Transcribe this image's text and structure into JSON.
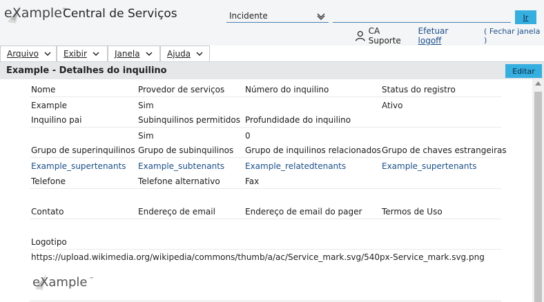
{
  "header": {
    "logo_text": "eXample",
    "logo_tm": "™",
    "app_title": "Central de Serviços",
    "search_type": "Incidente",
    "search_value": "",
    "go_label": "Ir",
    "user_name": "CA Suporte",
    "logoff_prefix": "Efetuar ",
    "logoff_underlined": "logoff",
    "close_window": "( Fechar janela )"
  },
  "menu": [
    {
      "label": "Arquivo"
    },
    {
      "label": "Exibir"
    },
    {
      "label": "Janela"
    },
    {
      "label": "Ajuda"
    }
  ],
  "page": {
    "title": "Example - Detalhes do inquilino",
    "edit_label": "Editar"
  },
  "details": {
    "row1": {
      "labels": [
        "Nome",
        "Provedor de serviços",
        "Número do inquilino",
        "Status do registro"
      ],
      "values": [
        "Example",
        "Sim",
        "",
        "Ativo"
      ]
    },
    "row2": {
      "labels": [
        "Inquilino pai",
        "Subinquilinos permitidos",
        "Profundidade do inquilino"
      ],
      "values": [
        "",
        "Sim",
        "0"
      ]
    },
    "row3": {
      "labels": [
        "Grupo de superinquilinos",
        "Grupo de subinquilinos",
        "Grupo de inquilinos relacionados",
        "Grupo de chaves estrangeiras"
      ],
      "links": [
        "Example_supertenants",
        "Example_subtenants",
        "Example_relatedtenants",
        "Example_supertenants"
      ]
    },
    "row4": {
      "labels": [
        "Telefone",
        "Telefone alternativo",
        "Fax"
      ]
    },
    "row5": {
      "labels": [
        "Contato",
        "Endereço de email",
        "Endereço de email do pager",
        "Termos de Uso"
      ]
    },
    "row6": {
      "label": "Logotipo",
      "value": "https://upload.wikimedia.org/wikipedia/commons/thumb/a/ac/Service_mark.svg/540px-Service_mark.svg.png"
    },
    "logo_image_text": "eXample"
  },
  "colors": {
    "accent": "#35aee0",
    "link": "#1a4f8b",
    "header_bg": "#f4f5f6",
    "titlebar_bg": "#e5e7e9"
  }
}
